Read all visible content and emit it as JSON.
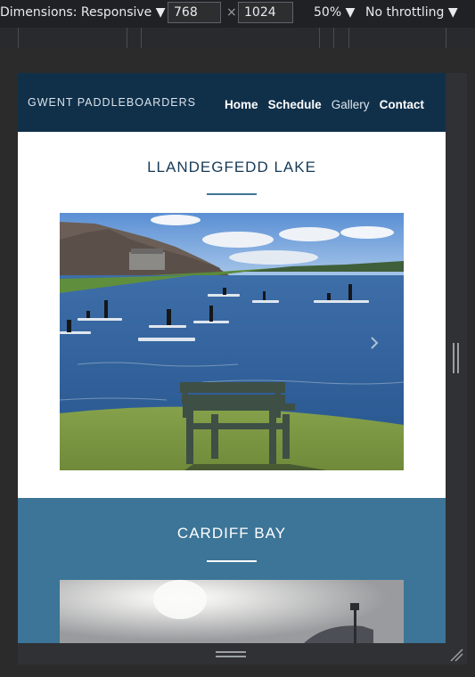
{
  "devtools": {
    "dimensions_label": "Dimensions: Responsive ▼",
    "width_value": "768",
    "times": "×",
    "height_value": "1024",
    "zoom_label": "50% ▼",
    "throttle_label": "No throttling ▼"
  },
  "site": {
    "brand": "GWENT PADDLEBOARDERS",
    "nav": [
      "Home",
      "Schedule",
      "Gallery",
      "Contact"
    ],
    "sections": [
      {
        "title": "LLANDEGFEDD LAKE"
      },
      {
        "title": "CARDIFF BAY"
      }
    ]
  },
  "colors": {
    "nav_bg": "#10304a",
    "section_blue": "#3c7597",
    "title_dark": "#163a56"
  }
}
